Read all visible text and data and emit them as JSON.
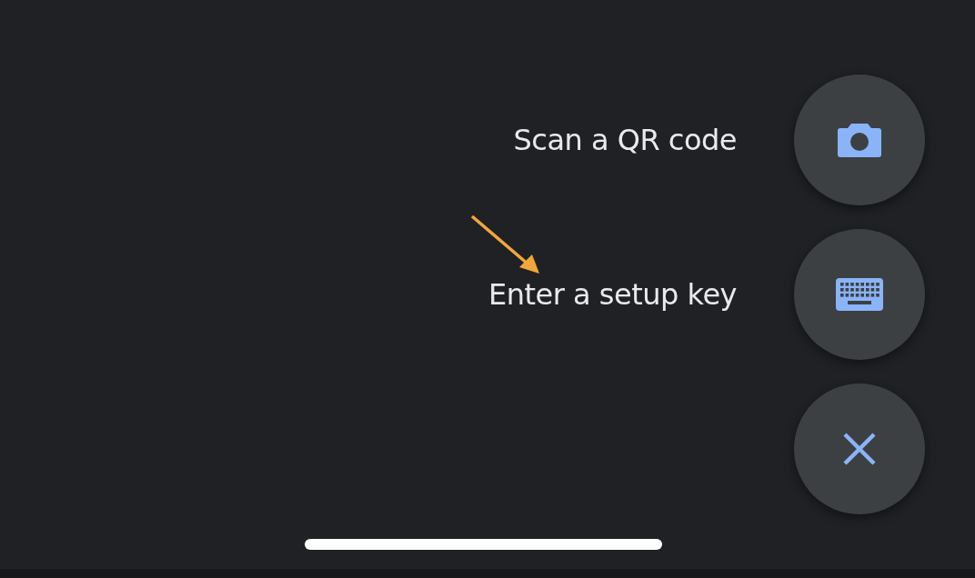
{
  "speed_dial": [
    {
      "label": "Scan a QR code",
      "kind": "camera"
    },
    {
      "label": "Enter a setup key",
      "kind": "keyboard"
    },
    {
      "kind": "close"
    }
  ]
}
